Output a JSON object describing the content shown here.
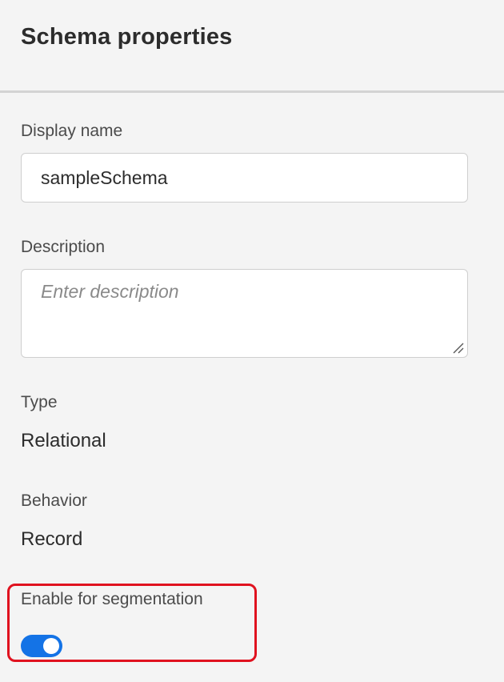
{
  "panel": {
    "title": "Schema properties"
  },
  "display_name": {
    "label": "Display name",
    "value": "sampleSchema"
  },
  "description": {
    "label": "Description",
    "placeholder": "Enter description",
    "value": ""
  },
  "type": {
    "label": "Type",
    "value": "Relational"
  },
  "behavior": {
    "label": "Behavior",
    "value": "Record"
  },
  "segmentation": {
    "label": "Enable for segmentation",
    "enabled": true
  },
  "colors": {
    "toggle_on": "#1473e6",
    "highlight": "#e0121f",
    "background": "#f4f4f4"
  }
}
